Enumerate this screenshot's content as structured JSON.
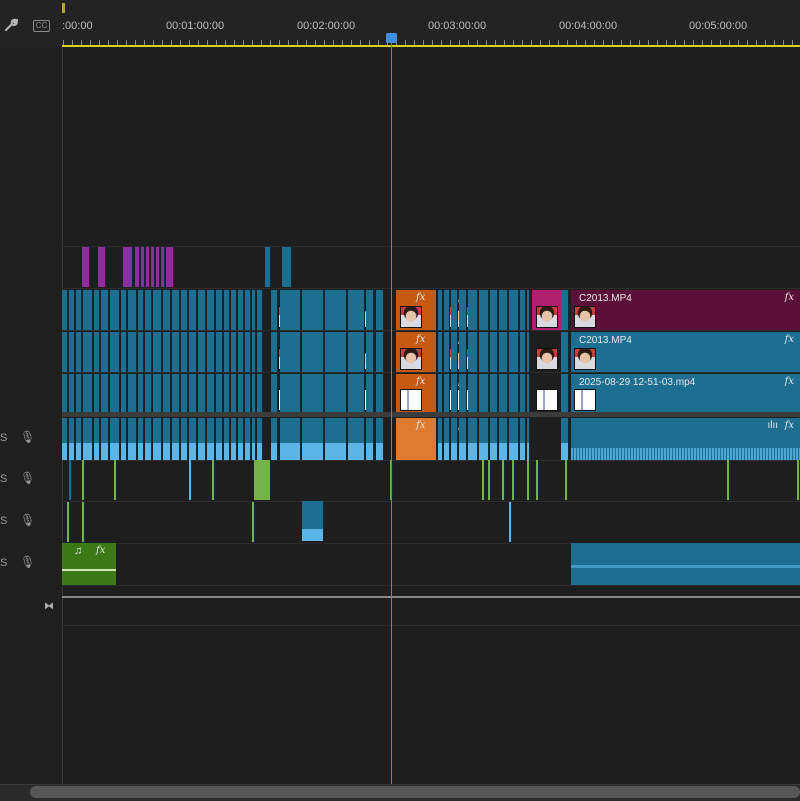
{
  "toolbar": {
    "wrench_icon": "wrench-icon",
    "captions_label": "CC"
  },
  "ruler": {
    "labels": [
      ":00:00",
      "00:01:00:00",
      "00:02:00:00",
      "00:03:00:00",
      "00:04:00:00",
      "00:05:00:00"
    ],
    "work_area_color": "#d8d11b",
    "playhead_color": "#3f8fe0"
  },
  "tracks": {
    "audio_letters": [
      "S",
      "S",
      "S",
      "S"
    ],
    "mic_icon": "microphone-icon",
    "bowtie_icon": "bowtie-icon"
  },
  "clips": {
    "v3_name": "C2013.MP4",
    "v2_name": "C2013.MP4",
    "v1_name": "2025-08-29 12-51-03.mp4",
    "fx": "fx",
    "music_note": "♫",
    "waveform_glyph": "ılıı"
  },
  "colors": {
    "video_teal": "#1d6f91",
    "audio_blue": "#5bb5e6",
    "purple": "#8b2ea0",
    "magenta": "#b0206e",
    "orange": "#c65a12",
    "green": "#3b7a16",
    "dark_magenta": "#5a1038"
  }
}
